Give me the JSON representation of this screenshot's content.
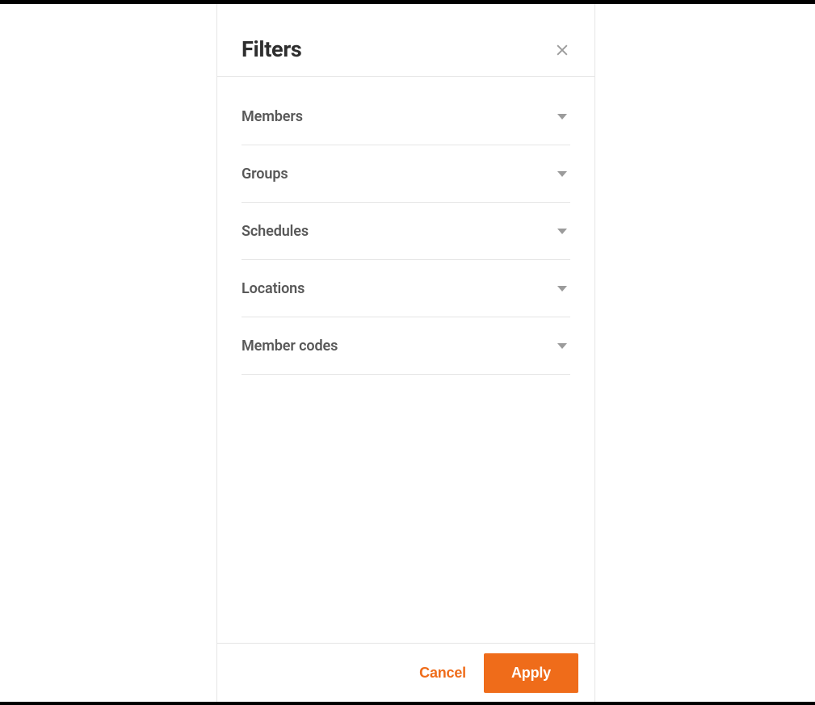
{
  "panel": {
    "title": "Filters",
    "sections": [
      {
        "label": "Members"
      },
      {
        "label": "Groups"
      },
      {
        "label": "Schedules"
      },
      {
        "label": "Locations"
      },
      {
        "label": "Member codes"
      }
    ],
    "actions": {
      "cancel": "Cancel",
      "apply": "Apply"
    }
  }
}
